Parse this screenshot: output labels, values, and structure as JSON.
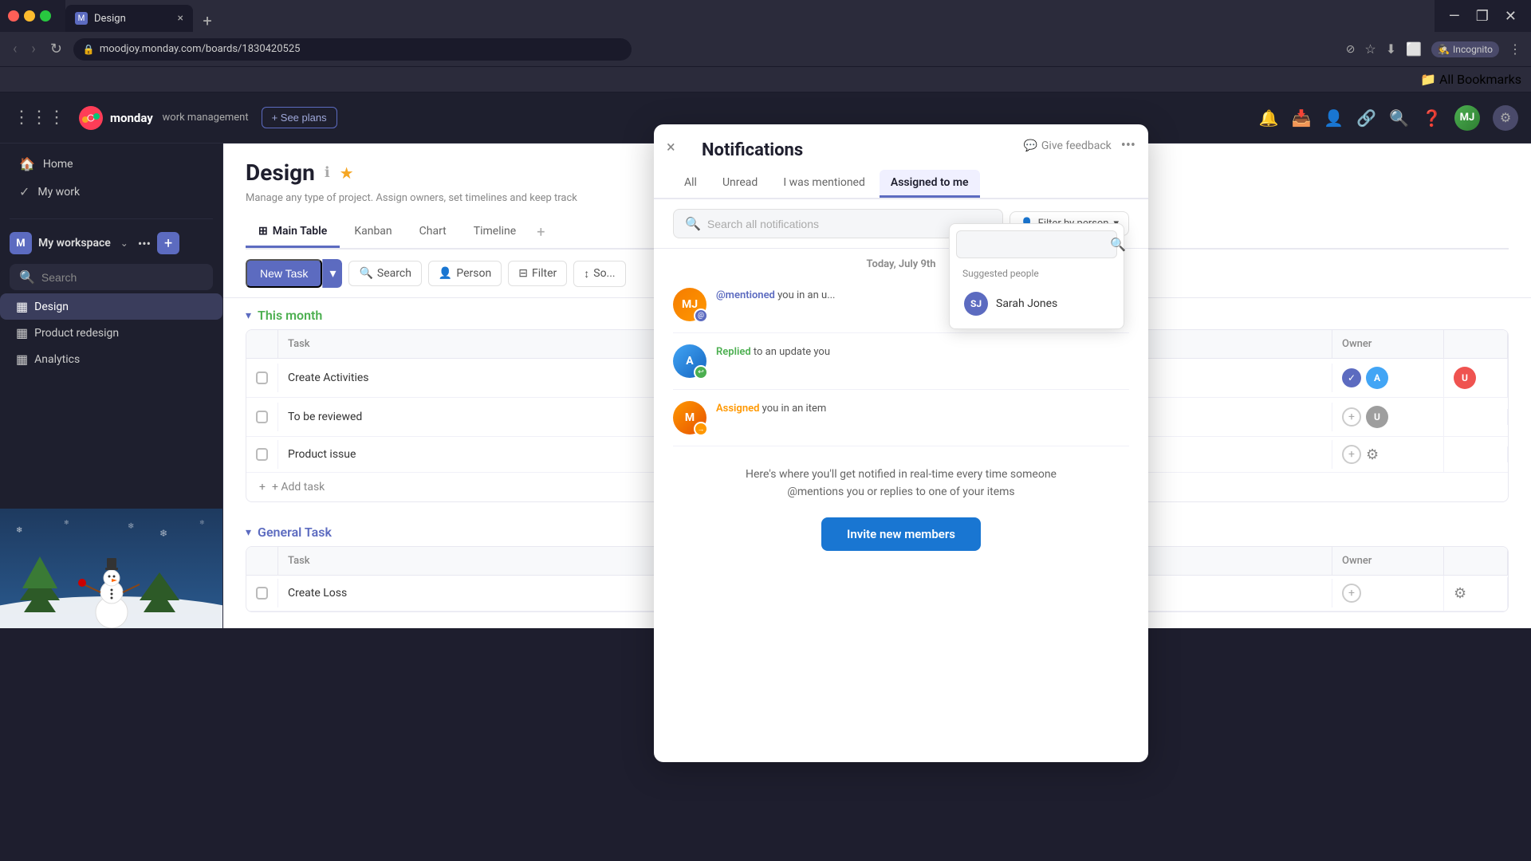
{
  "browser": {
    "tab_title": "Design",
    "url": "moodjoy.monday.com/boards/1830420525",
    "incognito_label": "Incognito",
    "bookmarks_label": "All Bookmarks"
  },
  "app": {
    "logo_brand": "monday",
    "logo_sub": "work management",
    "see_plans_label": "+ See plans"
  },
  "sidebar": {
    "home_label": "Home",
    "my_work_label": "My work",
    "search_placeholder": "Search",
    "workspace_name": "My workspace",
    "workspace_icon": "M",
    "boards": [
      {
        "name": "Design",
        "active": true
      },
      {
        "name": "Product redesign",
        "active": false
      },
      {
        "name": "Analytics",
        "active": false
      }
    ]
  },
  "board": {
    "title": "Design",
    "description": "Manage any type of project. Assign owners, set timelines and keep track",
    "tabs": [
      {
        "label": "Main Table",
        "active": true
      },
      {
        "label": "Kanban",
        "active": false
      },
      {
        "label": "Chart",
        "active": false
      },
      {
        "label": "Timeline",
        "active": false
      }
    ],
    "toolbar": {
      "new_task": "New Task",
      "search": "Search",
      "person": "Person",
      "filter": "Filter",
      "sort": "So..."
    },
    "groups": [
      {
        "title": "This month",
        "color": "green",
        "tasks": [
          {
            "name": "Create Activities",
            "status": "done"
          },
          {
            "name": "To be reviewed",
            "status": "pending"
          },
          {
            "name": "Product issue",
            "status": "pending"
          }
        ],
        "add_task": "+ Add task"
      },
      {
        "title": "General Task",
        "color": "blue",
        "tasks": [
          {
            "name": "Create Loss",
            "status": "pending"
          }
        ]
      }
    ],
    "col_headers": [
      "",
      "Task",
      "Owner",
      ""
    ]
  },
  "notifications": {
    "title": "Notifications",
    "close_label": "×",
    "give_feedback": "Give feedback",
    "tabs": [
      {
        "label": "All",
        "active": false
      },
      {
        "label": "Unread",
        "active": false
      },
      {
        "label": "I was mentioned",
        "active": false
      },
      {
        "label": "Assigned to me",
        "active": true
      }
    ],
    "search_placeholder": "Search all notifications",
    "filter_by_person": "Filter by person",
    "date_label": "Today, July 9th",
    "items": [
      {
        "type": "mentioned",
        "action": "@mentioned",
        "text": "you in an u...",
        "badge": "mention"
      },
      {
        "type": "replied",
        "action": "Replied",
        "text": "to an update you",
        "badge": "reply"
      },
      {
        "type": "assigned",
        "action": "Assigned",
        "text": "you in an item",
        "badge": "assign"
      }
    ],
    "empty_text_line1": "Here's where you'll get notified in real-time every time someone",
    "empty_text_line2": "@mentions you or replies to one of your items",
    "invite_btn": "Invite new members"
  },
  "filter_dropdown": {
    "search_placeholder": "",
    "suggested_label": "Suggested people",
    "people": [
      {
        "name": "Sarah Jones",
        "initials": "SJ"
      }
    ]
  }
}
